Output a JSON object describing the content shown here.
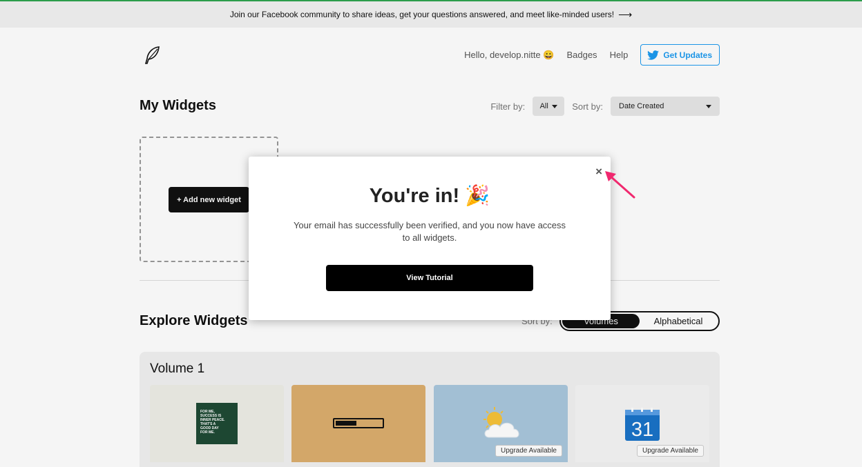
{
  "banner": {
    "text": "Join our Facebook community to share ideas, get your questions answered, and meet like-minded users!",
    "arrow": "⟶"
  },
  "header": {
    "logo_icon": "feather-icon",
    "greeting": "Hello, develop.nitte 😀",
    "badges": "Badges",
    "help": "Help",
    "updates_label": "Get Updates",
    "updates_icon": "twitter-icon",
    "accent": "#1d9bf0"
  },
  "my_widgets": {
    "title": "My Widgets",
    "filter_label": "Filter by:",
    "filter_value": "All",
    "sort_label": "Sort by:",
    "sort_value": "Date Created",
    "add_button": "+ Add new widget"
  },
  "explore": {
    "title": "Explore Widgets",
    "sort_label": "Sort by:",
    "sort_options": [
      "Volumes",
      "Alphabetical"
    ],
    "selected": "Volumes",
    "volume_title": "Volume 1",
    "cards": [
      {
        "name": "quote-widget",
        "quote": [
          "FOR ME,",
          "SUCCESS IS",
          "INNER PEACE.",
          "THAT'S A",
          "GOOD DAY",
          "FOR ME."
        ]
      },
      {
        "name": "progress-widget",
        "progress": 0.45
      },
      {
        "name": "weather-widget",
        "upgrade": "Upgrade Available"
      },
      {
        "name": "calendar-widget",
        "date": "31",
        "upgrade": "Upgrade Available"
      }
    ]
  },
  "modal": {
    "title": "You're in! 🎉",
    "message": "Your email has successfully been verified, and you now have access to all widgets.",
    "button": "View Tutorial",
    "close": "×"
  }
}
